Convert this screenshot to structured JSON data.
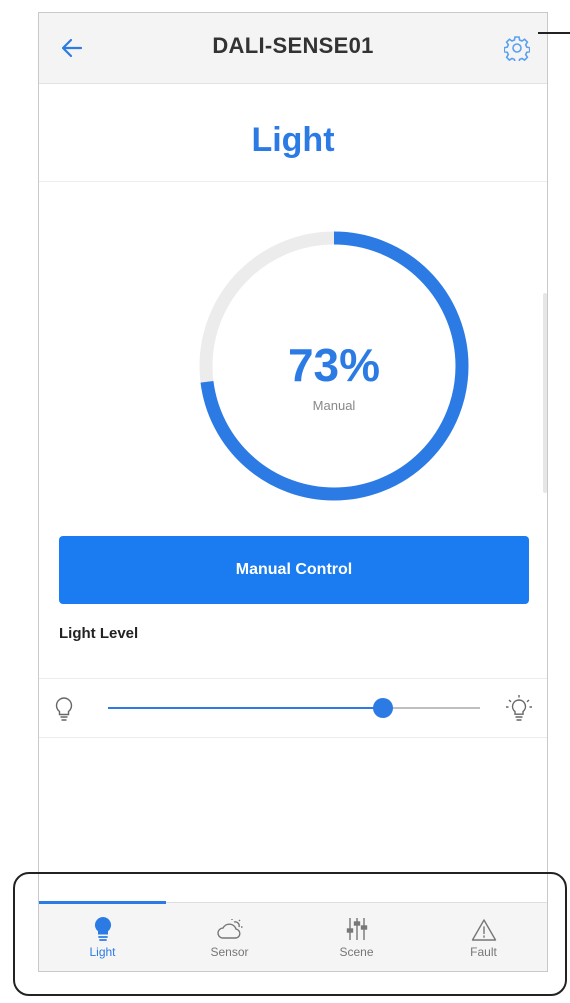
{
  "topbar": {
    "title": "DALI-SENSE01",
    "back_icon": "arrow-left-icon",
    "settings_icon": "gear-icon"
  },
  "page": {
    "heading": "Light"
  },
  "gauge": {
    "value_text": "73%",
    "value": 73,
    "mode": "Manual"
  },
  "actions": {
    "manual_control_label": "Manual Control"
  },
  "light_level": {
    "label": "Light Level",
    "slider_value_fraction": 0.74
  },
  "tabs": [
    {
      "label": "Light",
      "icon": "bulb-icon",
      "active": true
    },
    {
      "label": "Sensor",
      "icon": "sensor-cloud-icon",
      "active": false
    },
    {
      "label": "Scene",
      "icon": "sliders-icon",
      "active": false
    },
    {
      "label": "Fault",
      "icon": "warning-icon",
      "active": false
    }
  ],
  "colors": {
    "accent": "#2c7be5",
    "button": "#1a7cf0",
    "track": "#ececec"
  }
}
